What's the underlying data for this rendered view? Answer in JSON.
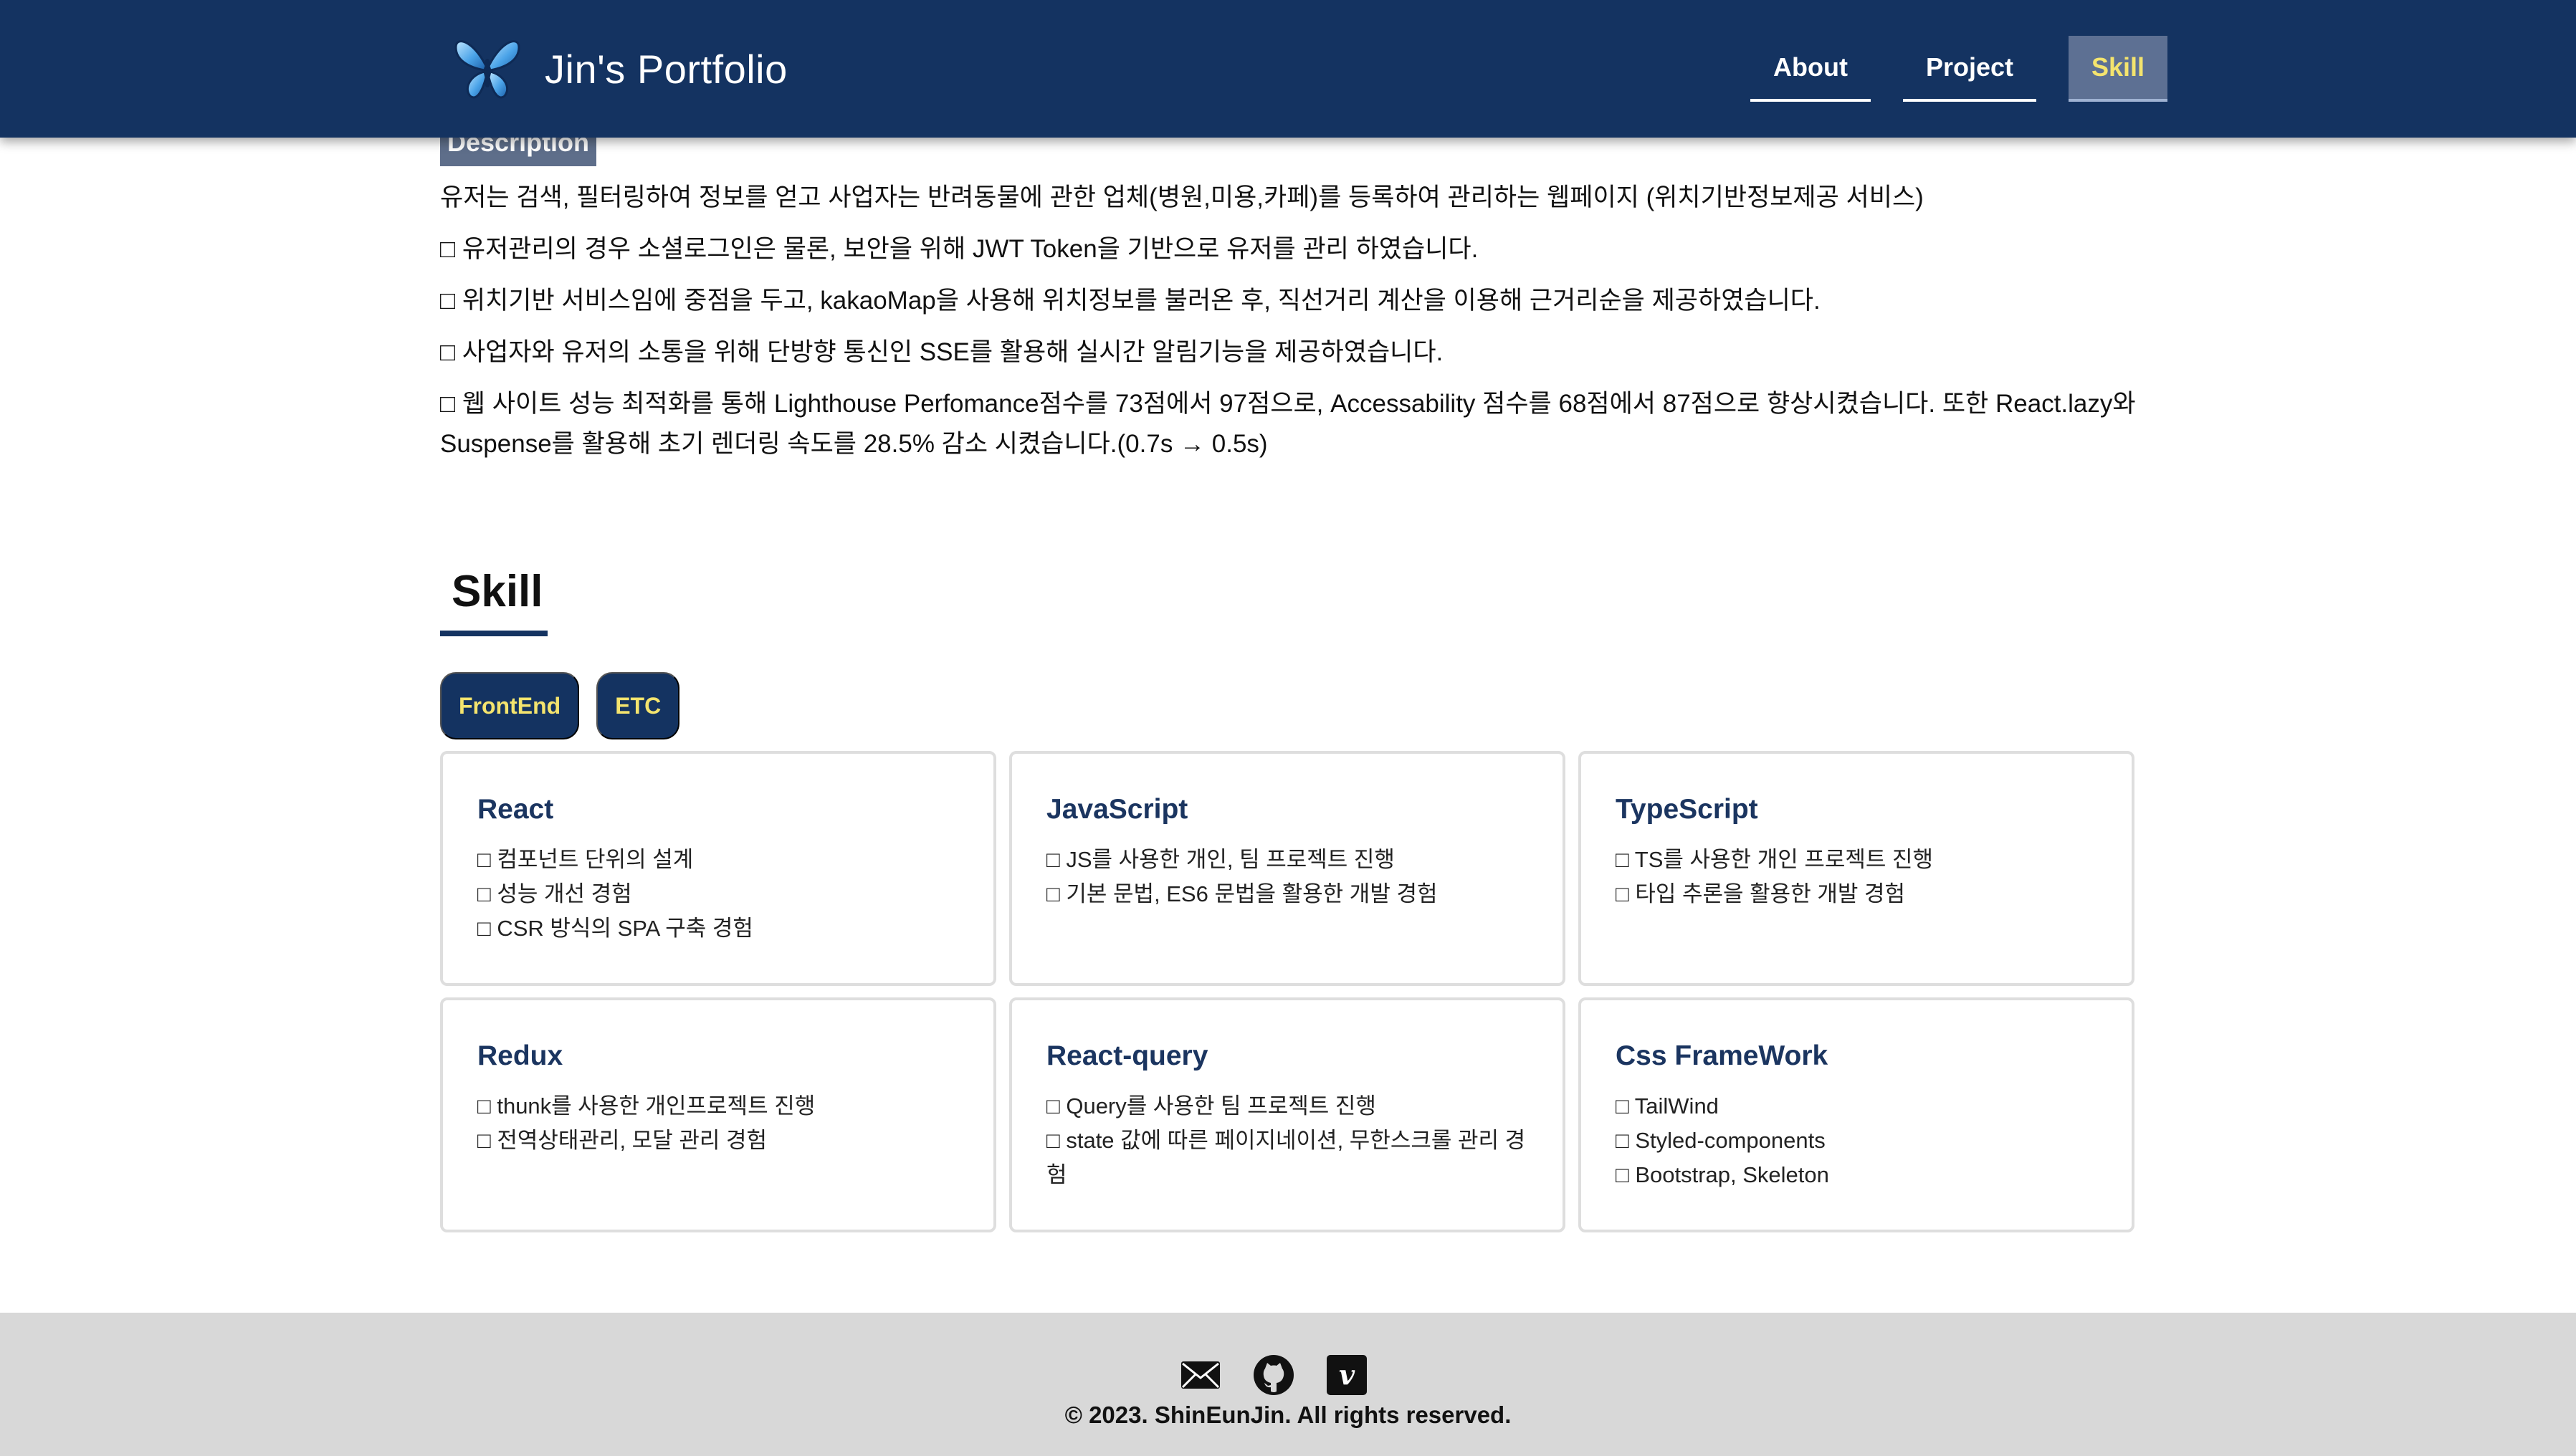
{
  "header": {
    "brand_title": "Jin's Portfolio",
    "brand_icon": "butterfly-icon",
    "nav": [
      {
        "label": "About",
        "active": false
      },
      {
        "label": "Project",
        "active": false
      },
      {
        "label": "Skill",
        "active": true
      }
    ]
  },
  "description": {
    "badge": "Description",
    "lines": [
      "유저는 검색, 필터링하여 정보를 얻고 사업자는 반려동물에 관한 업체(병원,미용,카페)를 등록하여 관리하는 웹페이지 (위치기반정보제공 서비스)",
      "□ 유저관리의 경우 소셜로그인은 물론, 보안을 위해 JWT Token을 기반으로 유저를 관리 하였습니다.",
      "□ 위치기반 서비스임에 중점을 두고, kakaoMap을 사용해 위치정보를 불러온 후, 직선거리 계산을 이용해 근거리순을 제공하였습니다.",
      "□ 사업자와 유저의 소통을 위해 단방향 통신인 SSE를 활용해 실시간 알림기능을 제공하였습니다.",
      "□ 웹 사이트 성능 최적화를 통해 Lighthouse Perfomance점수를 73점에서 97점으로, Accessability 점수를 68점에서 87점으로 향상시켰습니다. 또한 React.lazy와 Suspense를 활용해 초기 렌더링 속도를 28.5% 감소 시켰습니다.(0.7s → 0.5s)"
    ]
  },
  "skill": {
    "title": "Skill",
    "tabs": [
      "FrontEnd",
      "ETC"
    ],
    "cards": [
      {
        "title": "React",
        "items": [
          "□ 컴포넌트 단위의 설계",
          "□ 성능 개선 경험",
          "□ CSR 방식의 SPA 구축 경험"
        ]
      },
      {
        "title": "JavaScript",
        "items": [
          "□ JS를 사용한 개인, 팀 프로젝트 진행",
          "□ 기본 문법, ES6 문법을 활용한 개발 경험"
        ]
      },
      {
        "title": "TypeScript",
        "items": [
          "□ TS를 사용한 개인 프로젝트 진행",
          "□ 타입 추론을 활용한 개발 경험"
        ]
      },
      {
        "title": "Redux",
        "items": [
          "□ thunk를 사용한 개인프로젝트 진행",
          "□ 전역상태관리, 모달 관리 경험"
        ]
      },
      {
        "title": "React-query",
        "items": [
          "□ Query를 사용한 팀 프로젝트 진행",
          "□ state 값에 따른 페이지네이션, 무한스크롤 관리 경험"
        ]
      },
      {
        "title": "Css FrameWork",
        "items": [
          "□ TailWind",
          "□ Styled-components",
          "□ Bootstrap, Skeleton"
        ]
      }
    ]
  },
  "footer": {
    "icons": [
      "mail-icon",
      "github-icon",
      "velog-icon"
    ],
    "copyright": "© 2023. ShinEunJin. All rights reserved."
  },
  "colors": {
    "header_bg": "#143361",
    "accent_yellow": "#f4e46e",
    "footer_bg": "#d8d8d8"
  }
}
